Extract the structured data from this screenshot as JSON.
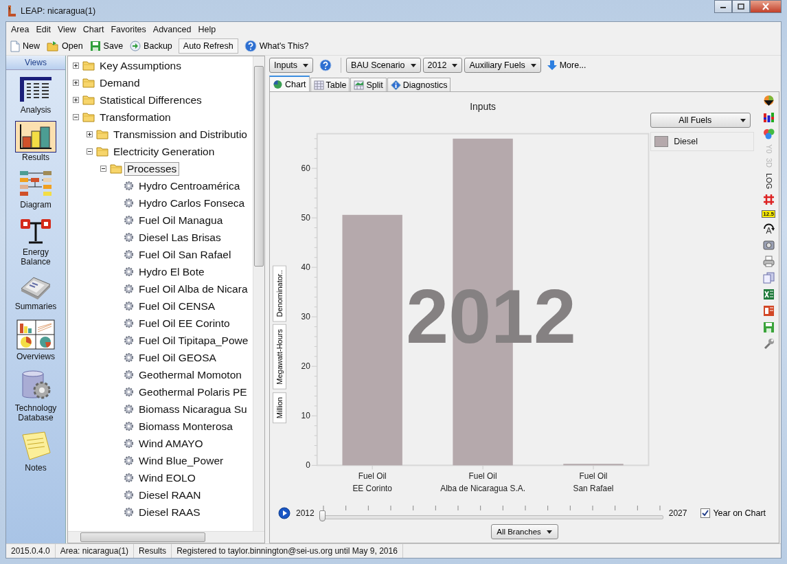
{
  "window": {
    "title": "LEAP: nicaragua(1)"
  },
  "menu": [
    "Area",
    "Edit",
    "View",
    "Chart",
    "Favorites",
    "Advanced",
    "Help"
  ],
  "toolbar": [
    {
      "label": "New",
      "kind": "new"
    },
    {
      "label": "Open",
      "kind": "open"
    },
    {
      "label": "Save",
      "kind": "save"
    },
    {
      "label": "Backup",
      "kind": "backup"
    },
    {
      "label": "Auto Refresh",
      "kind": "toggle"
    },
    {
      "label": "What's This?",
      "kind": "help"
    }
  ],
  "views": {
    "title": "Views",
    "items": [
      {
        "label": "Analysis",
        "kind": "analysis",
        "selected": false
      },
      {
        "label": "Results",
        "kind": "results",
        "selected": true
      },
      {
        "label": "Diagram",
        "kind": "diagram",
        "selected": false
      },
      {
        "label": "Energy Balance",
        "kind": "balance",
        "selected": false
      },
      {
        "label": "Summaries",
        "kind": "summaries",
        "selected": false
      },
      {
        "label": "Overviews",
        "kind": "overviews",
        "selected": false
      },
      {
        "label": "Technology Database",
        "kind": "database",
        "selected": false
      },
      {
        "label": "Notes",
        "kind": "notes",
        "selected": false
      }
    ]
  },
  "tree": [
    {
      "label": "Key Assumptions",
      "kind": "folder",
      "expanded": false,
      "selected": false
    },
    {
      "label": "Demand",
      "kind": "folder",
      "expanded": false,
      "selected": false
    },
    {
      "label": "Statistical Differences",
      "kind": "folder",
      "expanded": false,
      "selected": false
    },
    {
      "label": "Transformation",
      "kind": "folder",
      "expanded": true,
      "selected": false,
      "children": [
        {
          "label": "Transmission and Distributio",
          "kind": "folder",
          "expanded": false,
          "selected": false
        },
        {
          "label": "Electricity Generation",
          "kind": "folder",
          "expanded": true,
          "selected": false,
          "children": [
            {
              "label": "Processes",
              "kind": "folder",
              "expanded": true,
              "selected": true,
              "children": [
                {
                  "label": "Hydro Centroamérica",
                  "kind": "process",
                  "selected": false
                },
                {
                  "label": "Hydro Carlos Fonseca",
                  "kind": "process",
                  "selected": false
                },
                {
                  "label": "Fuel Oil Managua",
                  "kind": "process",
                  "selected": false
                },
                {
                  "label": "Diesel Las Brisas",
                  "kind": "process",
                  "selected": false
                },
                {
                  "label": "Fuel Oil San Rafael",
                  "kind": "process",
                  "selected": false
                },
                {
                  "label": "Hydro El Bote",
                  "kind": "process",
                  "selected": false
                },
                {
                  "label": "Fuel Oil Alba de Nicara",
                  "kind": "process",
                  "selected": false
                },
                {
                  "label": "Fuel Oil CENSA",
                  "kind": "process",
                  "selected": false
                },
                {
                  "label": "Fuel Oil EE Corinto",
                  "kind": "process",
                  "selected": false
                },
                {
                  "label": "Fuel Oil Tipitapa_Powe",
                  "kind": "process",
                  "selected": false
                },
                {
                  "label": "Fuel Oil GEOSA",
                  "kind": "process",
                  "selected": false
                },
                {
                  "label": "Geothermal Momoton",
                  "kind": "process",
                  "selected": false
                },
                {
                  "label": "Geothermal Polaris PE",
                  "kind": "process",
                  "selected": false
                },
                {
                  "label": "Biomass Nicaragua Su",
                  "kind": "process",
                  "selected": false
                },
                {
                  "label": "Biomass Monterosa",
                  "kind": "process",
                  "selected": false
                },
                {
                  "label": "Wind AMAYO",
                  "kind": "process",
                  "selected": false
                },
                {
                  "label": "Wind Blue_Power",
                  "kind": "process",
                  "selected": false
                },
                {
                  "label": "Wind EOLO",
                  "kind": "process",
                  "selected": false
                },
                {
                  "label": "Diesel RAAN",
                  "kind": "process",
                  "selected": false
                },
                {
                  "label": "Diesel RAAS",
                  "kind": "process",
                  "selected": false
                }
              ]
            }
          ]
        }
      ]
    }
  ],
  "results_toolbar": [
    {
      "kind": "dropdown",
      "label": "Inputs"
    },
    {
      "kind": "help"
    },
    {
      "kind": "dropdown",
      "label": "BAU Scenario"
    },
    {
      "kind": "dropdown",
      "label": "2012"
    },
    {
      "kind": "dropdown",
      "label": "Auxiliary Fuels"
    },
    {
      "kind": "more",
      "label": "More..."
    }
  ],
  "tabs": [
    {
      "label": "Chart",
      "kind": "chart",
      "selected": true
    },
    {
      "label": "Table",
      "kind": "table",
      "selected": false
    },
    {
      "label": "Split",
      "kind": "split",
      "selected": false
    },
    {
      "label": "Diagnostics",
      "kind": "diagnostics",
      "selected": false
    }
  ],
  "chart": {
    "unit_buttons": [
      "Denominator..",
      "Megawatt-Hours",
      "Million"
    ],
    "year_watermark": "2012",
    "fuel_filter": "All Fuels",
    "tools": [
      {
        "label": "Y0",
        "disabled": true
      },
      {
        "label": "3D",
        "disabled": true
      },
      {
        "label": "LOG",
        "disabled": false
      },
      {
        "label": "12.5",
        "disabled": false
      }
    ],
    "chart_data": {
      "type": "bar",
      "title": "Inputs",
      "categories": [
        "Fuel Oil\nEE Corinto",
        "Fuel Oil\nAlba de Nicaragua S.A.",
        "Fuel Oil\nSan Rafael"
      ],
      "series": [
        {
          "name": "Diesel",
          "color": "#b5a9ac",
          "values": [
            50.6,
            66.0,
            0.3
          ]
        }
      ],
      "ylim": [
        0,
        67
      ],
      "yticks": [
        0,
        10,
        20,
        30,
        40,
        50,
        60
      ]
    }
  },
  "timeline": {
    "start": "2012",
    "end": "2027",
    "level": 0,
    "year_on_chart": {
      "label": "Year on Chart",
      "checked": true
    }
  },
  "branch_filter": "All Branches",
  "status_bar": [
    "2015.0.4.0",
    "Area: nicaragua(1)",
    "Results",
    "Registered to taylor.binnington@sei-us.org until May 9, 2016"
  ]
}
